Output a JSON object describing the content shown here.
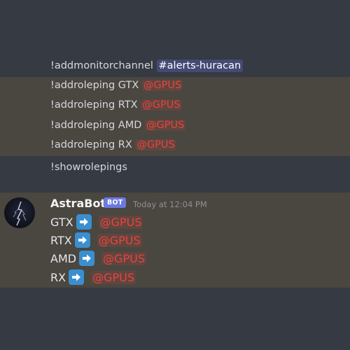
{
  "colors": {
    "background": "#363a42",
    "highlight": "#4a4640",
    "role_mention": "#e7443d",
    "channel_mention_bg": "#444a74",
    "bot_tag": "#6c79de",
    "arrow_emoji": "#3a8fd0"
  },
  "commands": {
    "monitor": {
      "command": "!addmonitorchannel ",
      "channel": "#alerts-huracan"
    },
    "roleping_lines": [
      {
        "command": "!addroleping GTX ",
        "role": "@GPUS"
      },
      {
        "command": "!addroleping RTX ",
        "role": "@GPUS"
      },
      {
        "command": "!addroleping AMD ",
        "role": "@GPUS"
      },
      {
        "command": "!addroleping RX ",
        "role": "@GPUS"
      }
    ],
    "show": "!showrolepings"
  },
  "bot_message": {
    "username": "AstraBot",
    "tag": "BOT",
    "timestamp": "Today at 12:04 PM",
    "avatar_icon": "lightning-avatar-icon",
    "arrow_icon": "right-arrow-emoji-icon",
    "lines": [
      {
        "label": "GTX",
        "role": "@GPUS"
      },
      {
        "label": "RTX",
        "role": "@GPUS"
      },
      {
        "label": "AMD",
        "role": "@GPUS"
      },
      {
        "label": "RX",
        "role": "@GPUS"
      }
    ]
  }
}
